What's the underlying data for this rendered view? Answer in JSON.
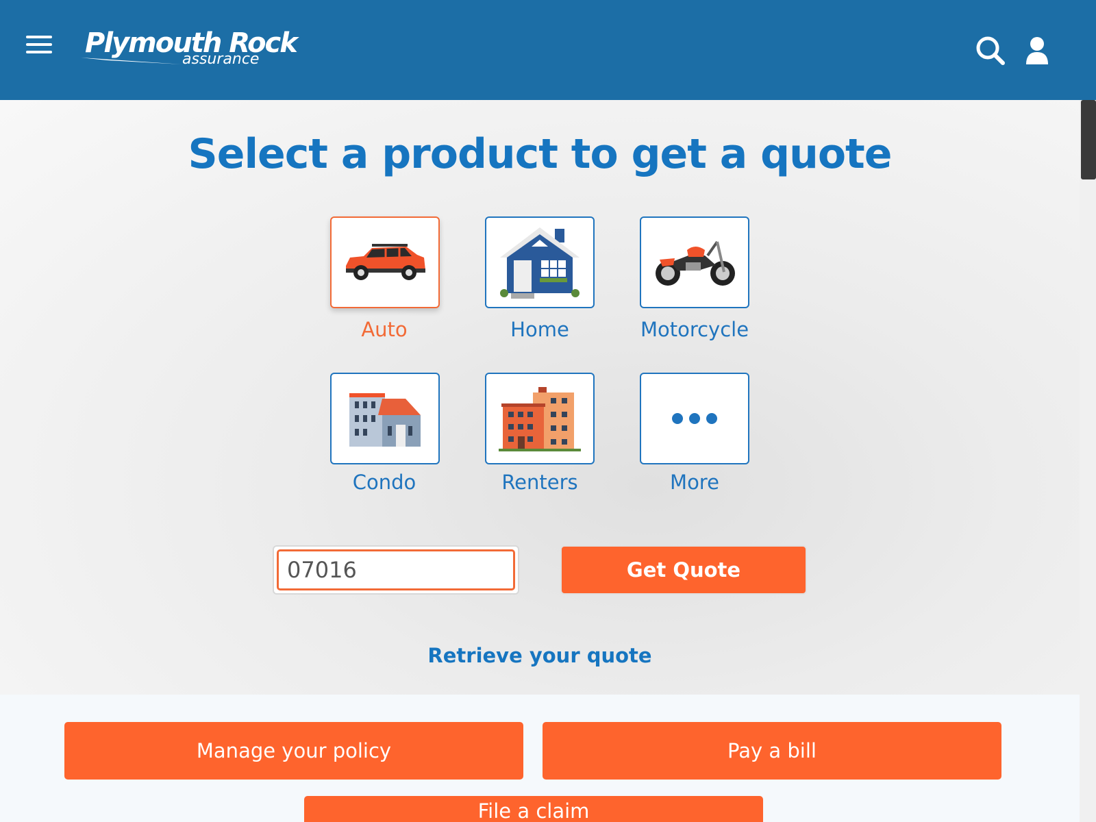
{
  "header": {
    "logo_brand": "Plymouth Rock",
    "logo_sub": "assurance",
    "colors": {
      "header_bg": "#1c6ea6",
      "accent": "#fe642d",
      "link_blue": "#1675c0"
    }
  },
  "main": {
    "title": "Select a product to get a quote",
    "products": [
      {
        "label": "Auto",
        "icon": "car-icon",
        "selected": true
      },
      {
        "label": "Home",
        "icon": "house-icon",
        "selected": false
      },
      {
        "label": "Motorcycle",
        "icon": "motorcycle-icon",
        "selected": false
      },
      {
        "label": "Condo",
        "icon": "condo-icon",
        "selected": false
      },
      {
        "label": "Renters",
        "icon": "apartment-icon",
        "selected": false
      },
      {
        "label": "More",
        "icon": "more-dots-icon",
        "selected": false
      }
    ],
    "zip_value": "07016",
    "get_quote_label": "Get Quote",
    "retrieve_label": "Retrieve your quote"
  },
  "actions": {
    "manage_policy": "Manage your policy",
    "pay_bill": "Pay a bill",
    "file_claim": "File a claim"
  }
}
